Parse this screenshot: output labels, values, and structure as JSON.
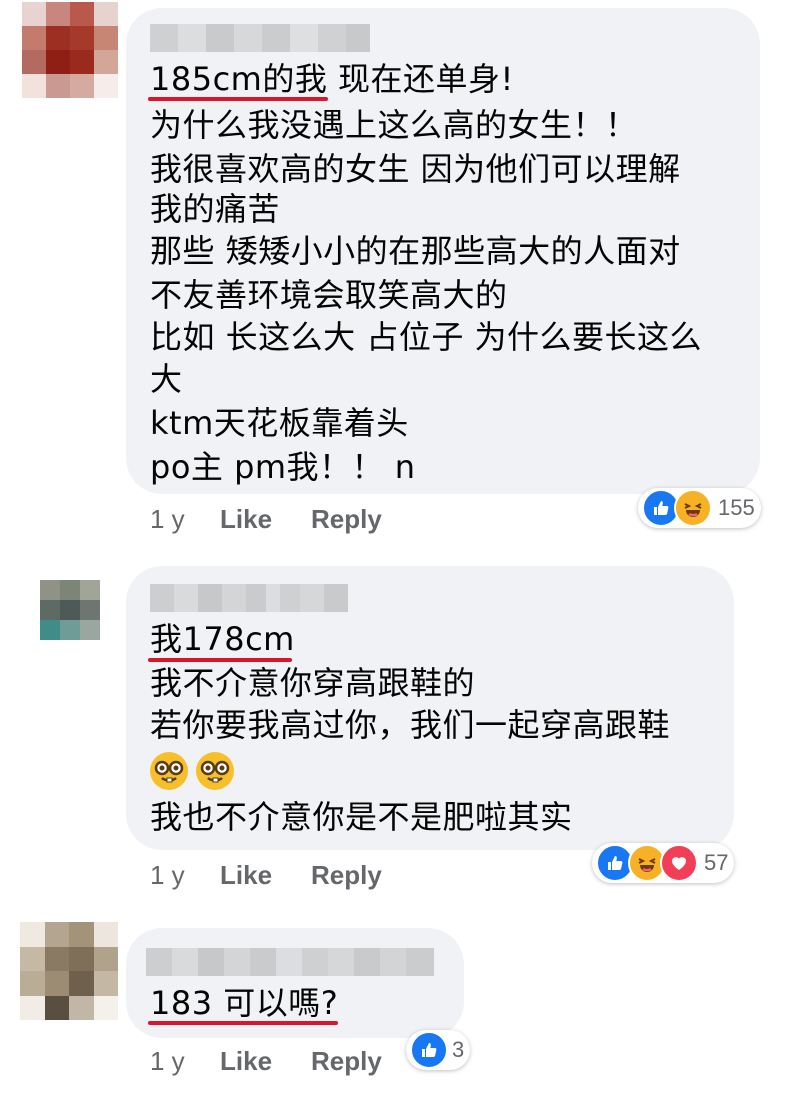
{
  "comments": [
    {
      "lines": [
        "185cm的我 现在还单身!",
        "为什么我没遇上这么高的女生！！",
        "我很喜欢高的女生 因为他们可以理解",
        "我的痛苦",
        "那些 矮矮小小的在那些高大的人面对",
        "不友善环境会取笑高大的",
        "比如 长这么大 占位子 为什么要长这么",
        "大",
        "ktm天花板靠着头",
        "po主 pm我！！ n"
      ],
      "time": "1 y",
      "like_label": "Like",
      "reply_label": "Reply",
      "reactions": [
        "like",
        "haha"
      ],
      "reaction_count": "155"
    },
    {
      "lines": [
        "我178cm",
        "我不介意你穿高跟鞋的",
        "若你要我高过你，我们一起穿高跟鞋",
        "我也不介意你是不是肥啦其实"
      ],
      "emoji": [
        "nerd-face",
        "nerd-face"
      ],
      "time": "1 y",
      "like_label": "Like",
      "reply_label": "Reply",
      "reactions": [
        "like",
        "haha",
        "love"
      ],
      "reaction_count": "57"
    },
    {
      "lines": [
        "183 可以嗎?"
      ],
      "time": "1 y",
      "like_label": "Like",
      "reply_label": "Reply",
      "reactions": [
        "like"
      ],
      "reaction_count": "3"
    }
  ],
  "colors": {
    "bubble": "#f0f2f5",
    "underline": "#d9162b",
    "like": "#1877f2",
    "haha": "#f7b125",
    "love": "#f33e58",
    "meta": "#65676b"
  }
}
